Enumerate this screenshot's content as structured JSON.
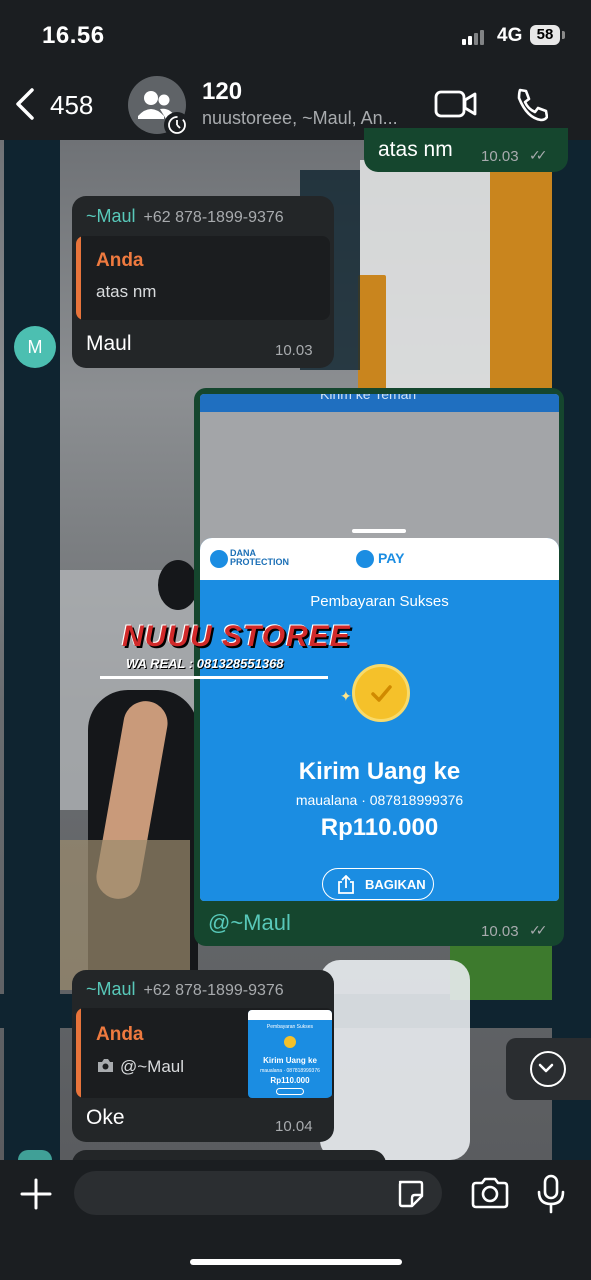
{
  "status_bar": {
    "time": "16.56",
    "network": "4G",
    "battery": "58"
  },
  "header": {
    "back_count": "458",
    "group_name": "120",
    "group_members": "nuustoreee, ~Maul, An..."
  },
  "messages": [
    {
      "type": "outgoing",
      "text": "atas nm",
      "time": "10.03"
    },
    {
      "type": "incoming",
      "sender": "~Maul",
      "sender_number": "+62 878-1899-9376",
      "avatar_letter": "M",
      "quote": {
        "name": "Anda",
        "text": "atas nm"
      },
      "text": "Maul",
      "time": "10.03"
    },
    {
      "type": "outgoing-image",
      "caption": "@~Maul",
      "time": "10.03",
      "image": {
        "top_title": "Kirim ke Teman",
        "dana_protection": "DANA PROTECTION",
        "pay_label": "PAY",
        "status": "Pembayaran Sukses",
        "title": "Kirim Uang ke",
        "recipient": "maualana · 087818999376",
        "amount": "Rp110.000",
        "share_label": "BAGIKAN"
      },
      "watermark": {
        "name": "NUUU STOREE",
        "contact": "WA REAL : 081328551368"
      }
    },
    {
      "type": "incoming",
      "sender": "~Maul",
      "sender_number": "+62 878-1899-9376",
      "quote": {
        "name": "Anda",
        "text": "@~Maul",
        "thumb": {
          "status": "Pembayaran Sukses",
          "title": "Kirim Uang ke",
          "recipient": "maualana · 087818999376",
          "amount": "Rp110.000"
        }
      },
      "text": "Oke",
      "time": "10.04"
    }
  ],
  "input": {
    "placeholder": ""
  },
  "colors": {
    "incoming_bubble": "#232628",
    "outgoing_bubble": "#15462e",
    "sender_name": "#58c8b9",
    "quote_name": "#ef7a3f",
    "dana_blue": "#1b8de2"
  }
}
